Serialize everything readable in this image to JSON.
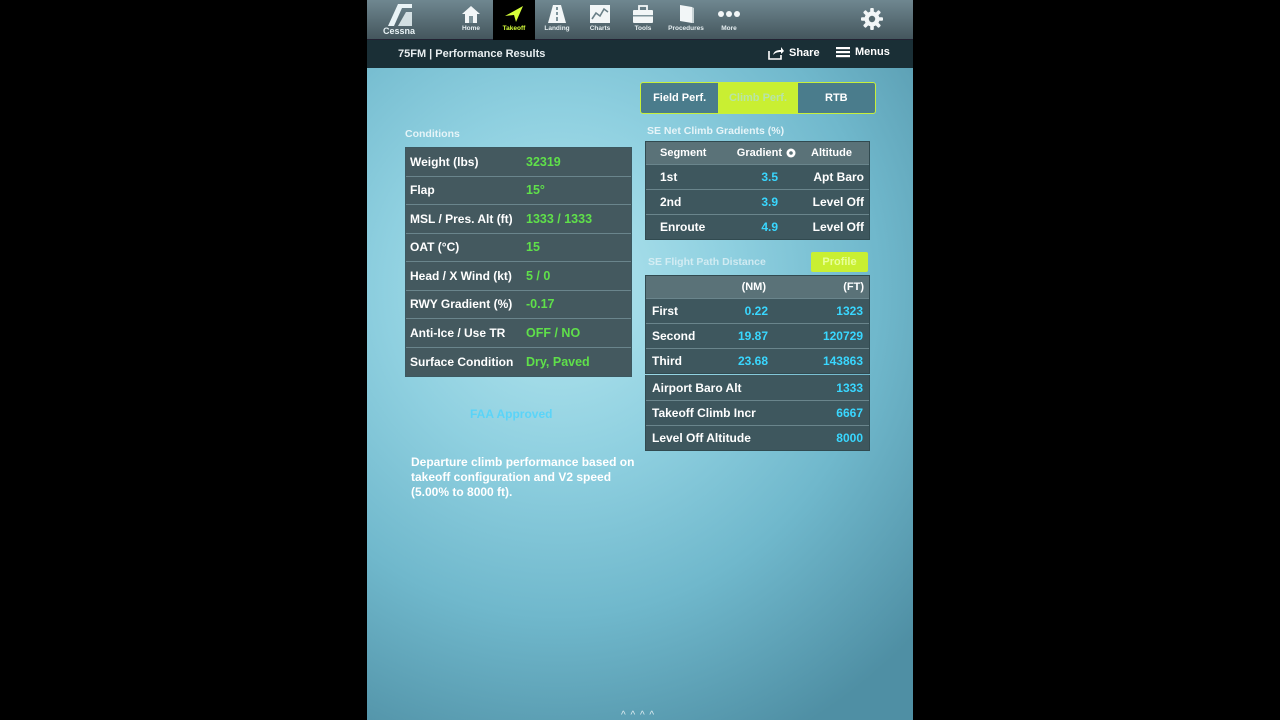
{
  "toolbar": {
    "logo_label": "Cessna",
    "tabs": [
      {
        "label": "Home"
      },
      {
        "label": "Takeoff"
      },
      {
        "label": "Landing"
      },
      {
        "label": "Charts"
      },
      {
        "label": "Tools"
      },
      {
        "label": "Procedures"
      },
      {
        "label": "More"
      }
    ],
    "active_tab": "Takeoff"
  },
  "subbar": {
    "title": "75FM | Performance Results",
    "share_label": "Share",
    "menus_label": "Menus"
  },
  "segments": [
    "Field Perf.",
    "Climb Perf.",
    "RTB"
  ],
  "conditions": {
    "label": "Conditions",
    "rows": [
      {
        "key": "Weight (lbs)",
        "value": "32319"
      },
      {
        "key": "Flap",
        "value": "15°"
      },
      {
        "key": "MSL / Pres. Alt (ft)",
        "value": "1333 / 1333"
      },
      {
        "key": "OAT (°C)",
        "value": "15"
      },
      {
        "key": "Head / X Wind (kt)",
        "value": "5 / 0"
      },
      {
        "key": "RWY Gradient (%)",
        "value": "-0.17"
      },
      {
        "key": "Anti-Ice / Use TR",
        "value": "OFF / NO"
      },
      {
        "key": "Surface Condition",
        "value": "Dry, Paved"
      }
    ]
  },
  "climb_gradients": {
    "label": "SE Net Climb Gradients (%)",
    "headers": [
      "Segment",
      "Gradient",
      "Altitude"
    ],
    "rows": [
      {
        "segment": "1st",
        "gradient": "3.5",
        "altitude": "Apt Baro"
      },
      {
        "segment": "2nd",
        "gradient": "3.9",
        "altitude": "Level Off"
      },
      {
        "segment": "Enroute",
        "gradient": "4.9",
        "altitude": "Level Off"
      }
    ]
  },
  "flight_path": {
    "label": "SE Flight Path Distance",
    "profile_label": "Profile",
    "headers": [
      "(NM)",
      "(FT)"
    ],
    "rows": [
      {
        "name": "First",
        "nm": "0.22",
        "ft": "1323"
      },
      {
        "name": "Second",
        "nm": "19.87",
        "ft": "120729"
      },
      {
        "name": "Third",
        "nm": "23.68",
        "ft": "143863"
      }
    ]
  },
  "altitudes": [
    {
      "name": "Airport Baro Alt",
      "value": "1333"
    },
    {
      "name": "Takeoff Climb Incr",
      "value": "6667"
    },
    {
      "name": "Level Off Altitude",
      "value": "8000"
    }
  ],
  "faa_label": "FAA Approved",
  "note": "Departure climb performance based on takeoff configuration and V2 speed (5.00% to 8000 ft).",
  "colors": {
    "accent": "#c9ef32",
    "value_green": "#5fe04a",
    "value_cyan": "#39d7ff"
  }
}
